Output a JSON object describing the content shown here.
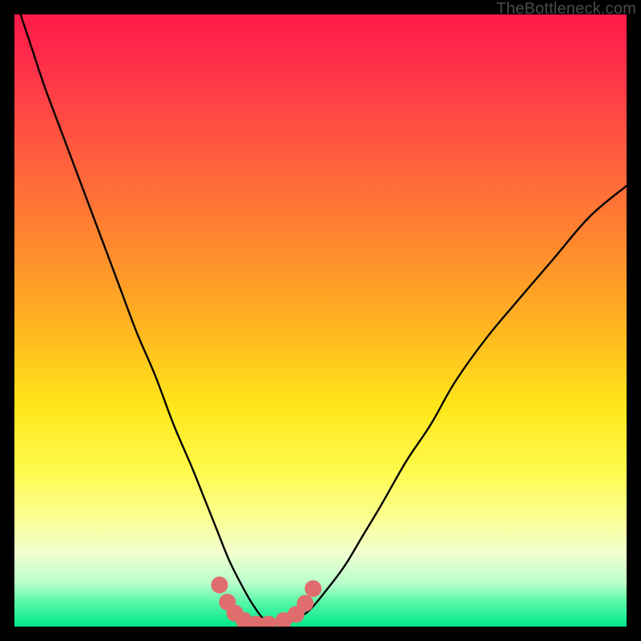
{
  "watermark": "TheBottleneck.com",
  "chart_data": {
    "type": "line",
    "title": "",
    "xlabel": "",
    "ylabel": "",
    "xlim": [
      0,
      100
    ],
    "ylim": [
      0,
      100
    ],
    "grid": false,
    "legend": false,
    "series": [
      {
        "name": "bottleneck-curve",
        "color": "#000000",
        "x": [
          1,
          3,
          5,
          8,
          11,
          14,
          17,
          20,
          23,
          26,
          29,
          31,
          33,
          35,
          37,
          39,
          41,
          43,
          45,
          48,
          51,
          54,
          57,
          60,
          64,
          68,
          72,
          77,
          82,
          88,
          94,
          100
        ],
        "y": [
          100,
          94,
          88,
          80,
          72,
          64,
          56,
          48,
          41,
          33,
          26,
          21,
          16,
          11,
          7,
          3.5,
          1,
          0.4,
          0.7,
          2.5,
          6,
          10,
          15,
          20,
          27,
          33,
          40,
          47,
          53,
          60,
          67,
          72
        ]
      },
      {
        "name": "fit-markers",
        "color": "#e06d6d",
        "marker_x": [
          33.5,
          34.8,
          36.0,
          37.5,
          39.5,
          41.5,
          44.0,
          46.0,
          47.5,
          48.8
        ],
        "marker_y": [
          6.8,
          4.0,
          2.2,
          1.0,
          0.4,
          0.4,
          1.0,
          2.0,
          3.8,
          6.2
        ]
      }
    ],
    "background_gradient": {
      "type": "vertical",
      "stops": [
        {
          "pos": 0.0,
          "color": "#ff1a47"
        },
        {
          "pos": 0.22,
          "color": "#ff5a3f"
        },
        {
          "pos": 0.52,
          "color": "#ffb81f"
        },
        {
          "pos": 0.74,
          "color": "#fff94a"
        },
        {
          "pos": 0.93,
          "color": "#b8ffca"
        },
        {
          "pos": 1.0,
          "color": "#00e88a"
        }
      ]
    }
  }
}
